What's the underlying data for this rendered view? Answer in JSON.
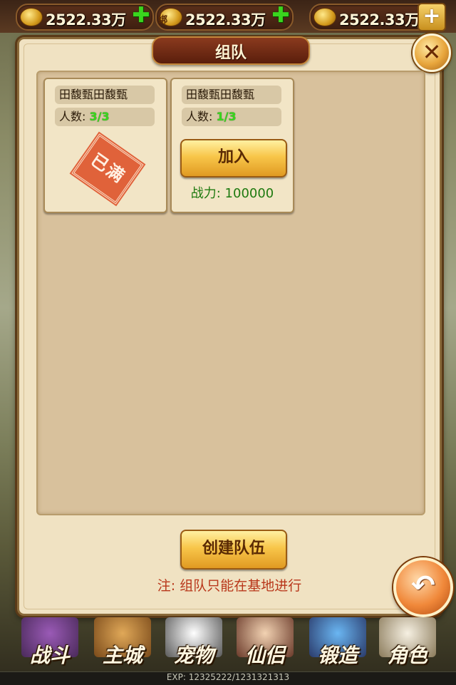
{
  "currency": [
    {
      "icon": "copper-coins-icon",
      "amount": "2522.33万",
      "action": "add-icon"
    },
    {
      "icon": "bound-gold-icon",
      "tag": "绑",
      "amount": "2522.33万",
      "action": "add-icon"
    },
    {
      "icon": "gold-ingot-icon",
      "amount": "2522.33万",
      "action": "recharge-plus-icon"
    }
  ],
  "dialog": {
    "title": "组队",
    "close_icon": "close-icon",
    "teams": [
      {
        "name": "田馥甄田馥甄",
        "count_label": "人数:",
        "count": "3/3",
        "full_stamp": "已满"
      },
      {
        "name": "田馥甄田馥甄",
        "count_label": "人数:",
        "count": "1/3",
        "join_label": "加入",
        "power": "战力: 100000"
      }
    ],
    "create_label": "创建队伍",
    "note": "注: 组队只能在基地进行"
  },
  "back_icon": "back-arrow-icon",
  "nav": [
    {
      "label": "战斗",
      "icon": "battle-icon"
    },
    {
      "label": "主城",
      "icon": "city-icon"
    },
    {
      "label": "宠物",
      "icon": "pet-panda-icon"
    },
    {
      "label": "仙侣",
      "icon": "companion-icon"
    },
    {
      "label": "锻造",
      "icon": "forge-icon"
    },
    {
      "label": "角色",
      "icon": "character-icon"
    }
  ],
  "exp": "EXP: 12325222/1231321313",
  "colors": {
    "accent_green": "#3ad61e",
    "note_red": "#b8361a",
    "power_green": "#1f7a10"
  }
}
